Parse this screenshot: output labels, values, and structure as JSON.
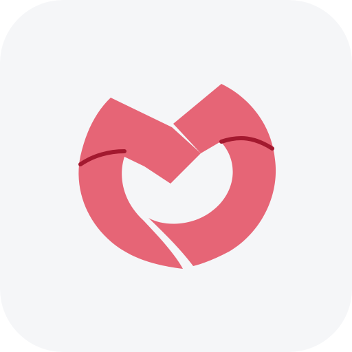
{
  "icon": {
    "name": "app-logo-icon",
    "background_color": "#f5f6f8",
    "primary_color": "#e66576",
    "accent_color": "#b01e35",
    "accent_stroke_color": "#a3192f"
  }
}
